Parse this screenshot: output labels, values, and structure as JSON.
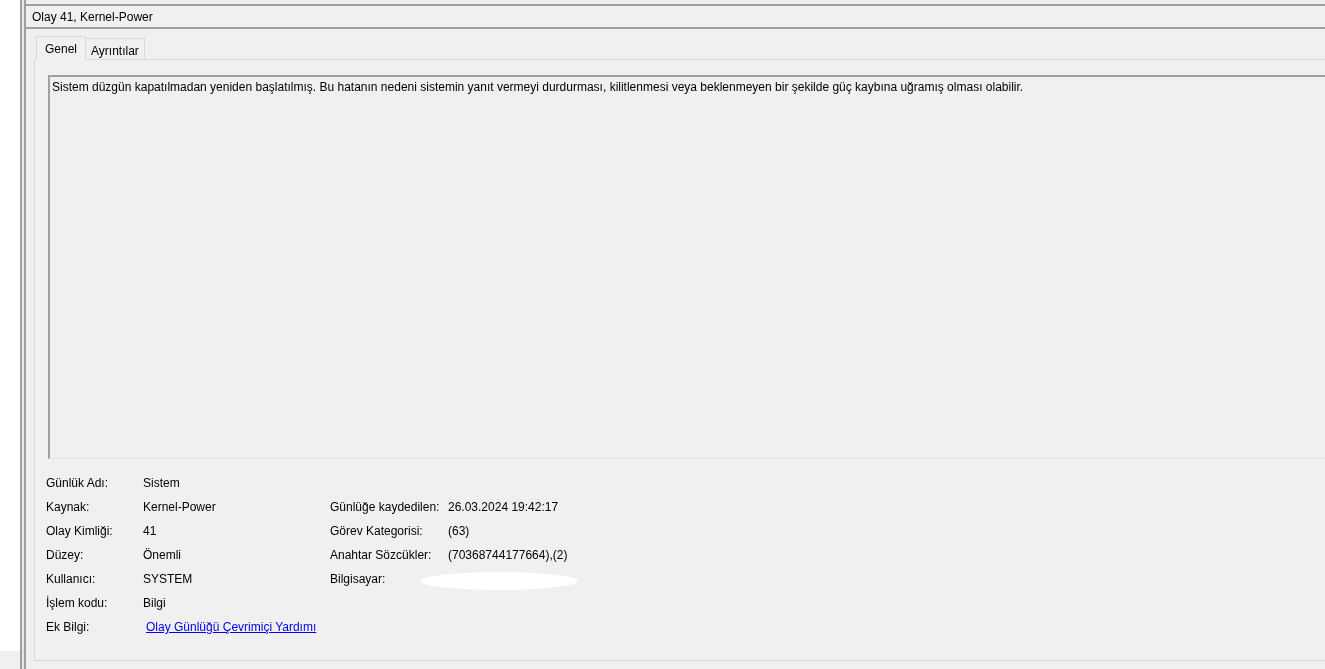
{
  "window": {
    "title": "Olay 41, Kernel-Power"
  },
  "tabs": [
    {
      "label": "Genel",
      "selected": true
    },
    {
      "label": "Ayrıntılar",
      "selected": false
    }
  ],
  "description": "Sistem düzgün kapatılmadan yeniden başlatılmış. Bu hatanın nedeni sistemin yanıt vermeyi durdurması, kilitlenmesi veya beklenmeyen bir şekilde güç kaybına uğramış olması olabilir.",
  "property_rows": [
    {
      "left": {
        "label": "Günlük Adı:",
        "value": "Sistem",
        "kind": "text"
      }
    },
    {
      "left": {
        "label": "Kaynak:",
        "value": "Kernel-Power",
        "kind": "text"
      },
      "right": {
        "label": "Günlüğe kaydedilen:",
        "value": "26.03.2024 19:42:17",
        "kind": "text"
      }
    },
    {
      "left": {
        "label": "Olay Kimliği:",
        "value": "41",
        "kind": "text"
      },
      "right": {
        "label": "Görev Kategorisi:",
        "value": "(63)",
        "kind": "text"
      }
    },
    {
      "left": {
        "label": "Düzey:",
        "value": "Önemli",
        "kind": "text"
      },
      "right": {
        "label": "Anahtar Sözcükler:",
        "value": "(70368744177664),(2)",
        "kind": "text"
      }
    },
    {
      "left": {
        "label": "Kullanıcı:",
        "value": "SYSTEM",
        "kind": "text"
      },
      "right": {
        "label": "Bilgisayar:",
        "kind": "redacted"
      }
    },
    {
      "left": {
        "label": "İşlem kodu:",
        "value": "Bilgi",
        "kind": "text"
      }
    },
    {
      "left": {
        "label": "Ek Bilgi:",
        "value": "Olay Günlüğü Çevrimiçi Yardımı",
        "kind": "link"
      }
    }
  ]
}
